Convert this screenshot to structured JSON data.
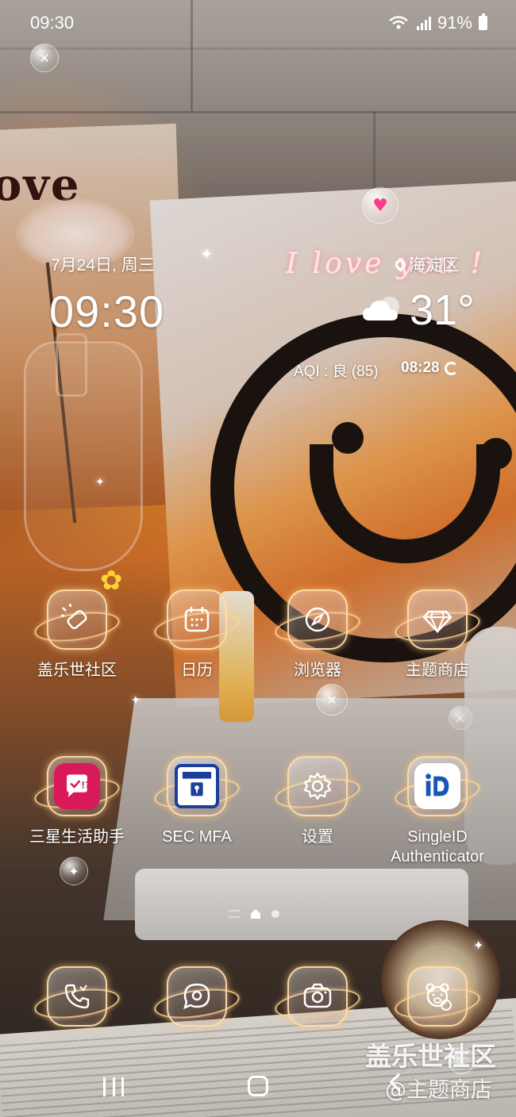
{
  "status_bar": {
    "time": "09:30",
    "battery_percent": "91%",
    "icons": [
      "wifi-icon",
      "signal-icon",
      "battery-icon"
    ]
  },
  "widget": {
    "date": "7月24日, 周三",
    "time": "09:30",
    "decorative_text": "I love you !",
    "location": "海淀区",
    "temperature": "31°",
    "weather_icon": "partly-cloudy-icon",
    "aqi": "AQI : 良 (85)",
    "updated_time": "08:28"
  },
  "apps": [
    {
      "label": "盖乐世社区",
      "icon": "flashlight-icon"
    },
    {
      "label": "日历",
      "icon": "calendar-icon"
    },
    {
      "label": "浏览器",
      "icon": "compass-icon"
    },
    {
      "label": "主题商店",
      "icon": "diamond-icon"
    },
    {
      "label": "三星生活助手",
      "icon": "checkmark-chat-icon"
    },
    {
      "label": "SEC MFA",
      "icon": "samsung-lock-icon"
    },
    {
      "label": "设置",
      "icon": "gear-icon"
    },
    {
      "label": "SingleID\nAuthenticator",
      "label_line1": "SingleID",
      "label_line2": "Authenticator",
      "icon": "id-icon"
    }
  ],
  "dock": [
    {
      "icon": "phone-icon"
    },
    {
      "icon": "message-icon"
    },
    {
      "icon": "camera-icon"
    },
    {
      "icon": "bear-icon"
    }
  ],
  "page_indicator": {
    "pages": 2,
    "current": 1
  },
  "watermark": {
    "line1": "盖乐世社区",
    "line2": "@主题商店"
  },
  "colors": {
    "icon_border": "#ffdcaa",
    "sec_mfa_blue": "#1a3f9c",
    "life_assistant_pink": "#d91a5a",
    "id_blue": "#1556b8"
  }
}
